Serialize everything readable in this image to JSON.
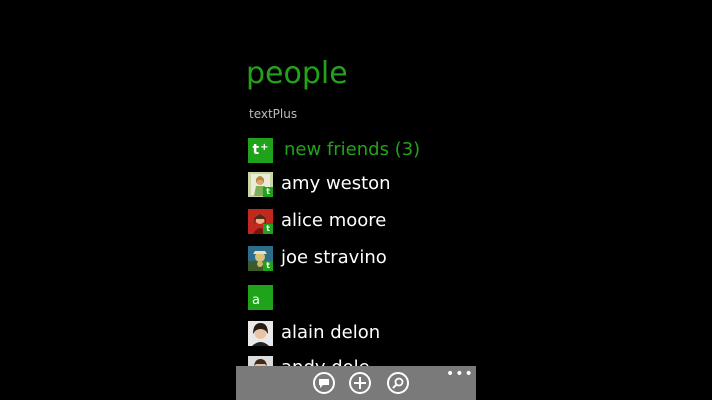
{
  "header": {
    "title": "people",
    "subtitle": "textPlus"
  },
  "new_friends": {
    "icon": "textplus-add-icon",
    "label": "new friends (3)"
  },
  "contacts": [
    {
      "name": "amy weston",
      "badge": "t"
    },
    {
      "name": "alice moore",
      "badge": "t"
    },
    {
      "name": "joe stravino",
      "badge": "t"
    }
  ],
  "group_letter": "a",
  "group_contacts": [
    {
      "name": "alain delon"
    },
    {
      "name": "andy dole"
    }
  ],
  "app_bar": {
    "buttons": [
      "message-icon",
      "add-icon",
      "search-icon"
    ],
    "more_icon": "more-icon"
  },
  "colors": {
    "accent": "#1ea31a",
    "background": "#000000",
    "app_bar": "#7a7a7a"
  }
}
